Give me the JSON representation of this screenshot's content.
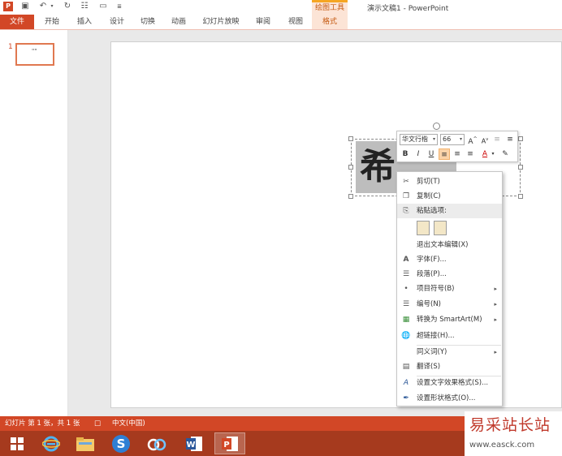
{
  "titlebar": {
    "context_tools": "绘图工具",
    "doc_title": "演示文稿1 - PowerPoint"
  },
  "ribbon": {
    "tabs": [
      "文件",
      "开始",
      "插入",
      "设计",
      "切换",
      "动画",
      "幻灯片放映",
      "审阅",
      "视图",
      "格式"
    ]
  },
  "thumbnails": {
    "slide_number": "1",
    "slide_preview_text": "\"\""
  },
  "slide": {
    "visible_glyph": "希"
  },
  "minibar": {
    "font_name": "华文行楷",
    "font_size": "66",
    "grow_font": "A",
    "shrink_font": "A",
    "bold": "B",
    "italic": "I",
    "underline": "U",
    "font_color": "A"
  },
  "context_menu": {
    "items": [
      {
        "label": "剪切(T)",
        "icon": "scissors-icon"
      },
      {
        "label": "复制(C)",
        "icon": "copy-icon"
      },
      {
        "label": "粘贴选项:",
        "icon": "paste-icon"
      },
      {
        "label": "退出文本编辑(X)",
        "icon": ""
      },
      {
        "label": "字体(F)...",
        "icon": "font-icon"
      },
      {
        "label": "段落(P)...",
        "icon": "paragraph-icon"
      },
      {
        "label": "项目符号(B)",
        "icon": "bullets-icon",
        "submenu": true
      },
      {
        "label": "编号(N)",
        "icon": "numbering-icon",
        "submenu": true
      },
      {
        "label": "转换为 SmartArt(M)",
        "icon": "smartart-icon",
        "submenu": true
      },
      {
        "label": "超链接(H)...",
        "icon": "hyperlink-icon"
      },
      {
        "label": "同义词(Y)",
        "icon": "",
        "submenu": true
      },
      {
        "label": "翻译(S)",
        "icon": "translate-icon"
      },
      {
        "label": "设置文字效果格式(S)...",
        "icon": "text-effects-icon"
      },
      {
        "label": "设置形状格式(O)...",
        "icon": "shape-format-icon"
      }
    ]
  },
  "statusbar": {
    "slide_info": "幻灯片 第 1 张，共 1 张",
    "language": "中文(中国)"
  },
  "watermark": {
    "title": "易采站长站",
    "url": "www.easck.com"
  },
  "colors": {
    "accent": "#d24726",
    "taskbar": "#a63a1e",
    "context_tab": "#fce4d6"
  }
}
